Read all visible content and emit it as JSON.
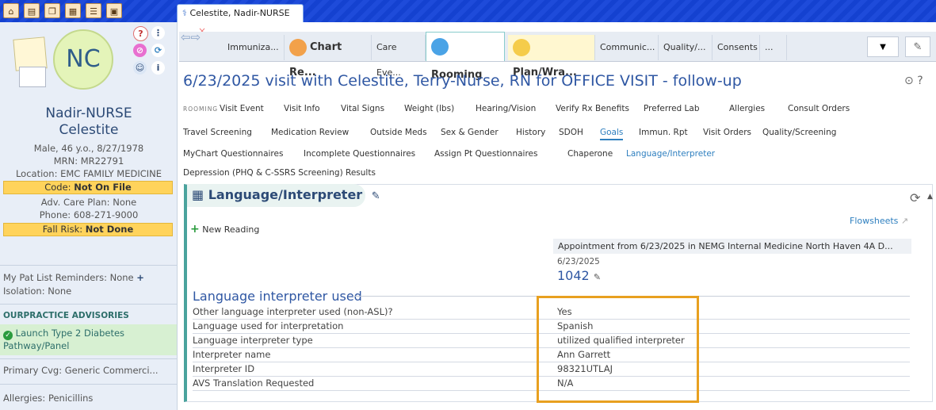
{
  "toolbar": {
    "icons": [
      "home-icon",
      "inbox-icon",
      "sheets-icon",
      "calendar-icon",
      "list-icon",
      "window-icon"
    ]
  },
  "patient_tab": {
    "label": "Celestite, Nadir-NURSE",
    "close": "×"
  },
  "patient": {
    "initials": "NC",
    "name_line1": "Nadir-NURSE",
    "name_line2": "Celestite",
    "demographics": "Male, 46 y.o., 8/27/1978",
    "mrn": "MRN: MR22791",
    "location": "Location: EMC FAMILY MEDICINE",
    "code_label": "Code: ",
    "code_value": "Not On File",
    "adv_care_plan": "Adv. Care Plan: None",
    "phone": "Phone: 608-271-9000",
    "fall_label": "Fall Risk: ",
    "fall_value": "Not Done",
    "reminders": "My Pat List Reminders: None",
    "reminders_add": "+",
    "isolation": "Isolation: None",
    "advisories_header": "OURPRACTICE ADVISORIES",
    "advisory": "Launch Type 2 Diabetes Pathway/Panel",
    "coverage": "Primary Cvg: Generic Commerci...",
    "allergies": "Allergies: Penicillins"
  },
  "tabs": [
    {
      "label": "Immuniza..."
    },
    {
      "label": "Chart Re..."
    },
    {
      "label": "Care Eve..."
    },
    {
      "label": "Rooming"
    },
    {
      "label": "Plan/Wra..."
    },
    {
      "label": "Communic..."
    },
    {
      "label": "Quality/..."
    },
    {
      "label": "Consents"
    },
    {
      "label": "..."
    }
  ],
  "visit_title": "6/23/2025 visit with Celestite, Terry-Nurse, RN for OFFICE VISIT - follow-up",
  "activities": {
    "rooming": "ROOMING",
    "row1": [
      "Visit Event",
      "Visit Info",
      "Vital Signs",
      "Weight (lbs)",
      "Hearing/Vision",
      "Verify Rx Benefits",
      "Preferred Lab",
      "Allergies",
      "Consult Orders"
    ],
    "row2": [
      "Travel Screening",
      "Medication Review",
      "Outside Meds",
      "Sex & Gender",
      "History",
      "SDOH",
      "Goals",
      "Immun. Rpt",
      "Visit Orders",
      "Quality/Screening"
    ],
    "row3": [
      "MyChart Questionnaires",
      "Incomplete Questionnaires",
      "Assign Pt Questionnaires",
      "Chaperone",
      "Language/Interpreter"
    ],
    "row4": [
      "Depression (PHQ & C-SSRS Screening) Results"
    ]
  },
  "section": {
    "title": "Language/Interpreter",
    "new_reading": "New Reading",
    "flowsheets": "Flowsheets",
    "appointment": "Appointment from 6/23/2025 in NEMG Internal Medicine North Haven 4A D...",
    "date": "6/23/2025",
    "time": "1042",
    "group_title": "Language interpreter used",
    "rows": [
      {
        "label": "Other language interpreter used (non-ASL)?",
        "value": "Yes"
      },
      {
        "label": "Language used for interpretation",
        "value": "Spanish"
      },
      {
        "label": "Language interpreter type",
        "value": "utilized qualified interpreter"
      },
      {
        "label": "Interpreter name",
        "value": "Ann Garrett"
      },
      {
        "label": "Interpreter ID",
        "value": "98321UTLAJ"
      },
      {
        "label": "AVS Translation Requested",
        "value": "N/A"
      }
    ]
  },
  "colors": {
    "highlight": "#e8a020",
    "accent": "#2f57a3",
    "banner": "#1544d8",
    "warning": "#ffd35b"
  }
}
